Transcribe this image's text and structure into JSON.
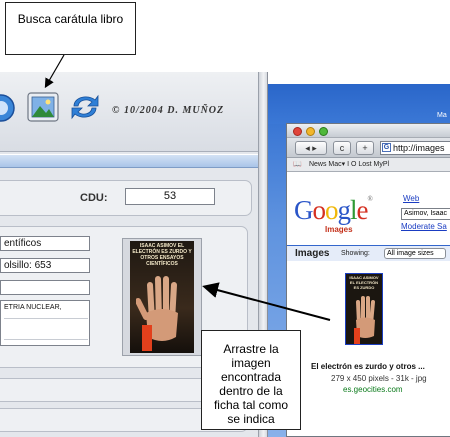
{
  "callouts": {
    "top": "Busca carátula libro",
    "bottom": "Arrastre la imagen encontrada dentro de la ficha tal como se indica"
  },
  "app": {
    "copyright": "© 10/2004 D. MUÑOZ",
    "cdu_label": "CDU:",
    "cdu_value": "53",
    "fields": [
      "entíficos",
      "olsillo: 653",
      "",
      "ETRIA NUCLEAR,"
    ],
    "cover_text": "ISAAC ASIMOV EL ELECTRÓN ES ZURDO Y OTROS ENSAYOS CIENTÍFICOS"
  },
  "desktop": {
    "menu_fragment": "Ma"
  },
  "browser": {
    "url": "http://images",
    "nav_refresh": "c",
    "nav_add": "+",
    "bookmarks": "News Mac▾   I   O   Lost   MyPl",
    "google_logo": {
      "letters": [
        "G",
        "o",
        "o",
        "g",
        "l",
        "e"
      ],
      "colors": [
        "#2a55c8",
        "#d53021",
        "#f0b80a",
        "#2a55c8",
        "#2f9a34",
        "#d53021"
      ],
      "registered": "®",
      "sub": "Images"
    },
    "web_link": "Web",
    "search_value": "Asimov, Isaac",
    "moderate_link": "Moderate Sa",
    "images_bar": {
      "title": "Images",
      "showing": "Showing:",
      "size_option": "All image sizes"
    },
    "result": {
      "thumb_text": "ISAAC ASIMOV EL ELECTRÓN ES ZURDO",
      "title": "El electrón es zurdo y otros ...",
      "meta": "279 x 450 pixels - 31k - jpg",
      "url": "es.geocities.com"
    }
  }
}
